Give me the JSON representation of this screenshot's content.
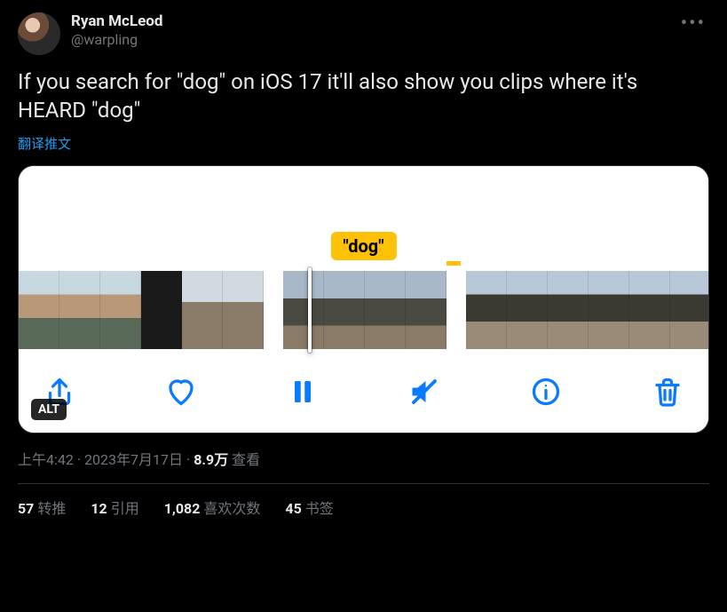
{
  "author": {
    "display_name": "Ryan McLeod",
    "handle": "@warpling"
  },
  "tweet_text": "If you search for \"dog\" on iOS 17 it'll also show you clips where it's HEARD \"dog\"",
  "translate_label": "翻译推文",
  "media": {
    "search_token": "\"dog\"",
    "alt_badge": "ALT",
    "toolbar_icons": {
      "share": "share-icon",
      "heart": "heart-icon",
      "pause": "pause-icon",
      "mute": "mute-icon",
      "info": "info-icon",
      "trash": "trash-icon"
    }
  },
  "meta": {
    "time": "上午4:42",
    "date": "2023年7月17日",
    "views_number": "8.9万",
    "views_label": "查看"
  },
  "stats": {
    "retweets_n": "57",
    "retweets_label": "转推",
    "quotes_n": "12",
    "quotes_label": "引用",
    "likes_n": "1,082",
    "likes_label": "喜欢次数",
    "bookmarks_n": "45",
    "bookmarks_label": "书签"
  }
}
